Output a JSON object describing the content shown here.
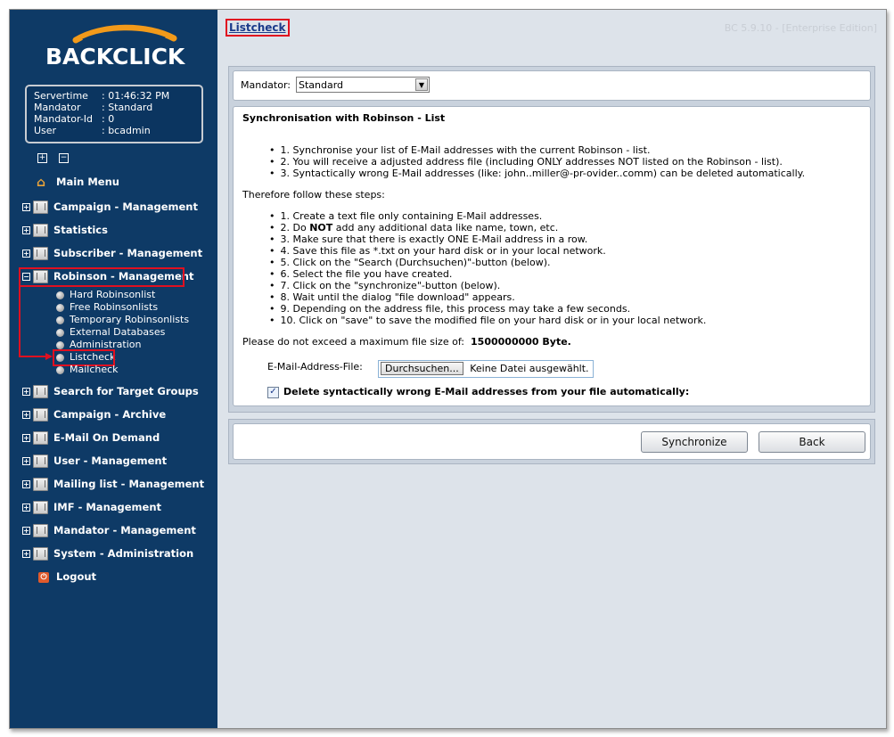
{
  "app": {
    "logo_text": "BACKCLICK",
    "page_title": "Listcheck",
    "version": "BC 5.9.10 - [Enterprise Edition]"
  },
  "info": {
    "servertime_label": "Servertime",
    "servertime_value": ": 01:46:32 PM",
    "mandator_label": "Mandator",
    "mandator_value": ": Standard",
    "mandator_id_label": "Mandator-Id",
    "mandator_id_value": ": 0",
    "user_label": "User",
    "user_value": ": bcadmin"
  },
  "nav": {
    "main_menu": "Main Menu",
    "campaign_management": "Campaign - Management",
    "statistics": "Statistics",
    "subscriber_management": "Subscriber - Management",
    "robinson_management": "Robinson - Management",
    "robinson_sub": [
      "Hard Robinsonlist",
      "Free Robinsonlists",
      "Temporary Robinsonlists",
      "External Databases",
      "Administration",
      "Listcheck",
      "Mailcheck"
    ],
    "search_target_groups": "Search for Target Groups",
    "campaign_archive": "Campaign - Archive",
    "email_on_demand": "E-Mail On Demand",
    "user_management": "User - Management",
    "mailing_list_management": "Mailing list - Management",
    "imf_management": "IMF - Management",
    "mandator_management": "Mandator - Management",
    "system_administration": "System - Administration",
    "logout": "Logout"
  },
  "mandator": {
    "label": "Mandator:",
    "selected": "Standard"
  },
  "sync": {
    "title": "Synchronisation with Robinson - List",
    "intro_items": [
      "1. Synchronise your list of E-Mail addresses with the current Robinson - list.",
      "2. You will receive a adjusted address file (including ONLY addresses NOT listed on the Robinson - list).",
      "3. Syntactically wrong E-Mail addresses (like: john..miller@-pr-ovider..comm) can be deleted automatically."
    ],
    "steps_heading": "Therefore follow these steps:",
    "step_1": "1. Create a text file only containing E-Mail addresses.",
    "step_2_pre": "2. Do ",
    "step_2_bold": "NOT",
    "step_2_post": " add any additional data like name, town, etc.",
    "steps_rest": [
      "3. Make sure that there is exactly ONE E-Mail address in a row.",
      "4. Save this file as *.txt on your hard disk or in your local network.",
      "5. Click on the \"Search (Durchsuchen)\"-button (below).",
      "6. Select the file you have created.",
      "7. Click on the \"synchronize\"-button (below).",
      "8. Wait until the dialog \"file download\" appears.",
      "9. Depending on the address file, this process may take a few seconds.",
      "10. Click on \"save\" to save the modified file on your hard disk or in your local network."
    ],
    "max_size_label": "Please do not exceed a maximum file size of:",
    "max_size_value": "1500000000 Byte.",
    "file_label": "E-Mail-Address-File:",
    "browse_button": "Durchsuchen...",
    "no_file": "Keine Datei ausgewählt.",
    "delete_wrong_label": "Delete syntactically wrong E-Mail addresses from your file automatically:",
    "delete_wrong_checked": true
  },
  "actions": {
    "synchronize": "Synchronize",
    "back": "Back"
  }
}
